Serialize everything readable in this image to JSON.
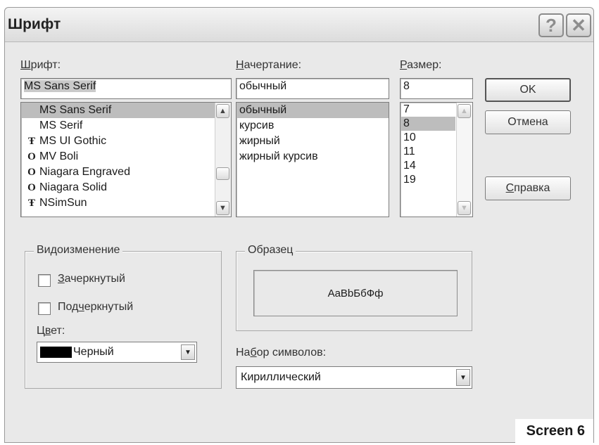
{
  "dialog": {
    "title": "Шрифт",
    "help_glyph": "?",
    "close_glyph": "✕"
  },
  "font": {
    "label_key": "Ш",
    "label_rest": "рифт:",
    "value": "MS Sans Serif",
    "items": [
      {
        "icon": "",
        "name": "MS Sans Serif",
        "selected": true
      },
      {
        "icon": "",
        "name": "MS Serif"
      },
      {
        "icon": "Ŧ",
        "name": "MS UI Gothic"
      },
      {
        "icon": "O",
        "name": "MV Boli"
      },
      {
        "icon": "O",
        "name": "Niagara Engraved"
      },
      {
        "icon": "O",
        "name": "Niagara Solid"
      },
      {
        "icon": "Ŧ",
        "name": "NSimSun"
      }
    ]
  },
  "style": {
    "label_key": "Н",
    "label_rest": "ачертание:",
    "value": "обычный",
    "items": [
      "обычный",
      "курсив",
      "жирный",
      "жирный курсив"
    ],
    "selected_index": 0
  },
  "size": {
    "label_key": "Р",
    "label_rest": "азмер:",
    "value": "8",
    "items": [
      "7",
      "8",
      "10",
      "11",
      "14",
      "19"
    ],
    "selected_index": 1
  },
  "buttons": {
    "ok": "OK",
    "cancel": "Отмена",
    "help_key": "С",
    "help_rest": "правка"
  },
  "effects": {
    "title": "Видоизменение",
    "strike_key": "З",
    "strike_rest": "ачеркнутый",
    "underline_pre": "Под",
    "underline_key": "ч",
    "underline_rest": "еркнутый",
    "color_pre": "Ц",
    "color_key": "в",
    "color_rest": "ет:",
    "color_value": "Черный",
    "color_hex": "#000000",
    "strikeout_checked": false,
    "underline_checked": false
  },
  "sample": {
    "title": "Образец",
    "text": "AaBbБбФф"
  },
  "charset": {
    "label_pre": "На",
    "label_key": "б",
    "label_rest": "ор символов:",
    "value": "Кириллический"
  },
  "caption": "Screen 6"
}
